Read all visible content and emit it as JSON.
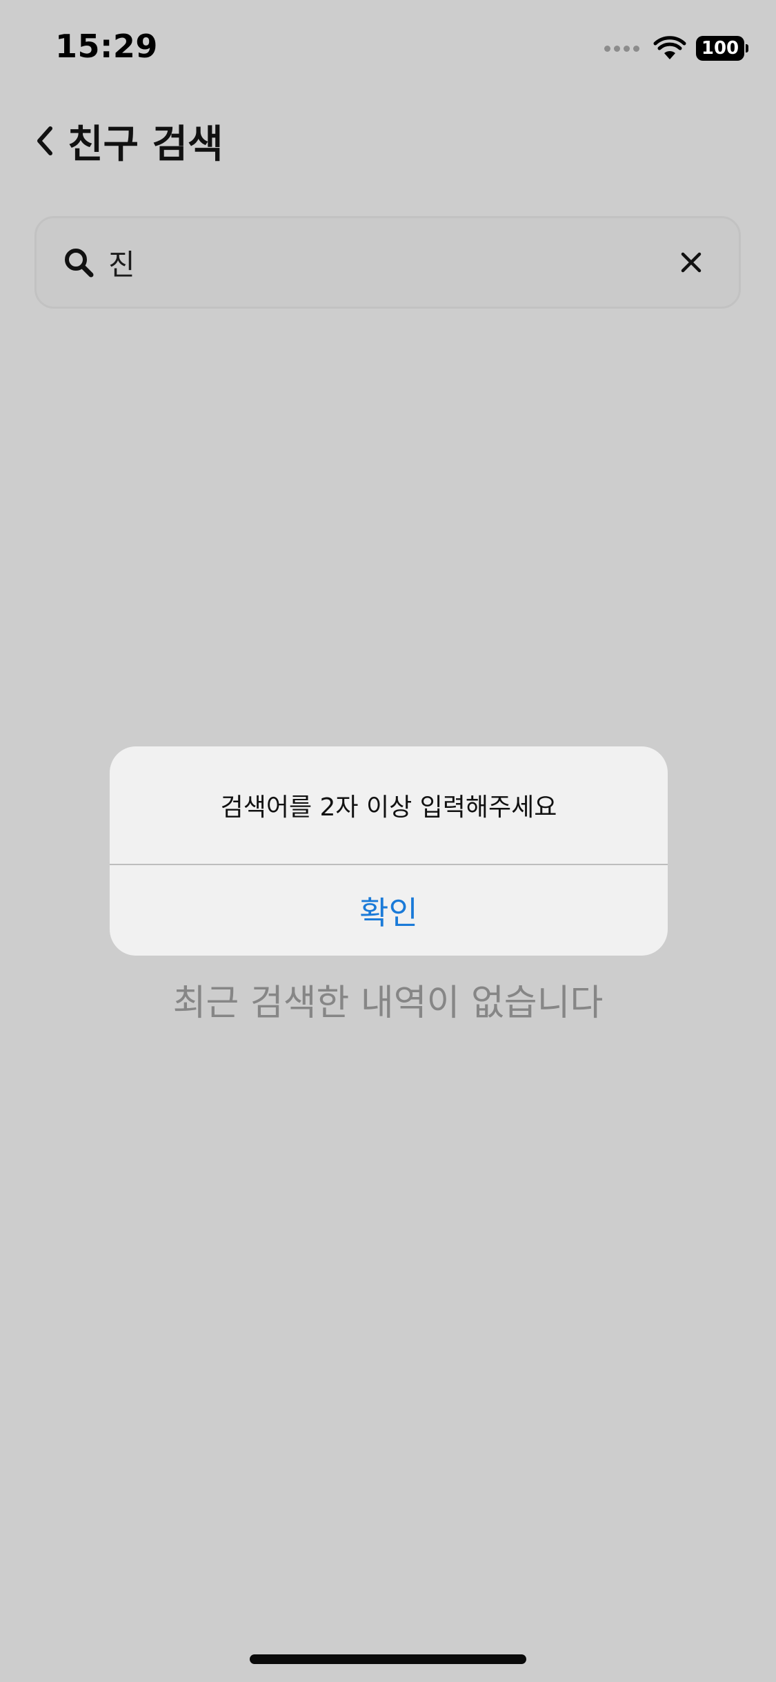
{
  "status_bar": {
    "time": "15:29",
    "battery": "100"
  },
  "header": {
    "back_icon": "chevron-left-icon",
    "title": "친구 검색"
  },
  "search": {
    "value": "진",
    "search_icon": "search-icon",
    "clear_icon": "close-icon"
  },
  "empty_state": {
    "message": "최근 검색한 내역이 없습니다"
  },
  "alert": {
    "message": "검색어를 2자 이상 입력해주세요",
    "confirm_label": "확인"
  },
  "colors": {
    "background": "#cdcdcd",
    "alert_background": "#f1f1f1",
    "accent": "#1a7ad8",
    "muted_text": "#868686"
  }
}
